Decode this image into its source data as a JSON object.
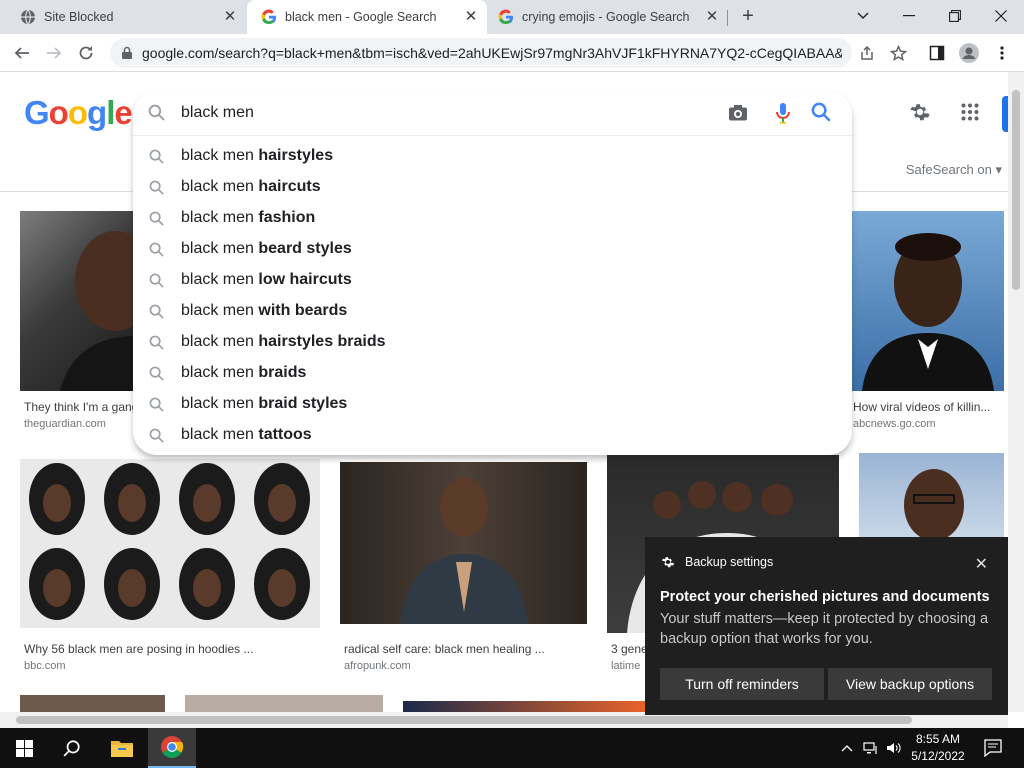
{
  "browser": {
    "tabs": [
      {
        "title": "Site Blocked",
        "active": false
      },
      {
        "title": "black men - Google Search",
        "active": true
      },
      {
        "title": "crying emojis - Google Search",
        "active": false
      }
    ],
    "url": "google.com/search?q=black+men&tbm=isch&ved=2ahUKEwjSr97mgNr3AhVJF1kFHYRNA7YQ2-cCegQIABAA&..."
  },
  "google": {
    "logo_letters": [
      "G",
      "o",
      "o",
      "g",
      "l",
      "e"
    ],
    "safesearch": "SafeSearch on"
  },
  "search": {
    "query": "black men",
    "suggestions": [
      {
        "prefix": "black men ",
        "bold": "hairstyles"
      },
      {
        "prefix": "black men ",
        "bold": "haircuts"
      },
      {
        "prefix": "black men ",
        "bold": "fashion"
      },
      {
        "prefix": "black men ",
        "bold": "beard styles"
      },
      {
        "prefix": "black men ",
        "bold": "low haircuts"
      },
      {
        "prefix": "black men ",
        "bold": "with beards"
      },
      {
        "prefix": "black men ",
        "bold": "hairstyles braids"
      },
      {
        "prefix": "black men ",
        "bold": "braids"
      },
      {
        "prefix": "black men ",
        "bold": "braid styles"
      },
      {
        "prefix": "black men ",
        "bold": "tattoos"
      }
    ]
  },
  "results": [
    {
      "caption": "They think I'm a gang",
      "source": "theguardian.com"
    },
    {
      "caption": "How viral videos of killin...",
      "source": "abcnews.go.com"
    },
    {
      "caption": "Why 56 black men are posing in hoodies ...",
      "source": "bbc.com"
    },
    {
      "caption": "radical self care: black men healing ...",
      "source": "afropunk.com"
    },
    {
      "caption": "3 gene",
      "source": "latime"
    }
  ],
  "notification": {
    "app": "Backup settings",
    "title": "Protect your cherished pictures and documents",
    "message": "Your stuff matters—keep it protected by choosing a backup option that works for you.",
    "button_dismiss": "Turn off reminders",
    "button_view": "View backup options"
  },
  "taskbar": {
    "time": "8:55 AM",
    "date": "5/12/2022"
  },
  "colors": {
    "accent": "#1a73e8",
    "toast_bg": "#1f1f1f",
    "taskbar_bg": "#101010"
  }
}
